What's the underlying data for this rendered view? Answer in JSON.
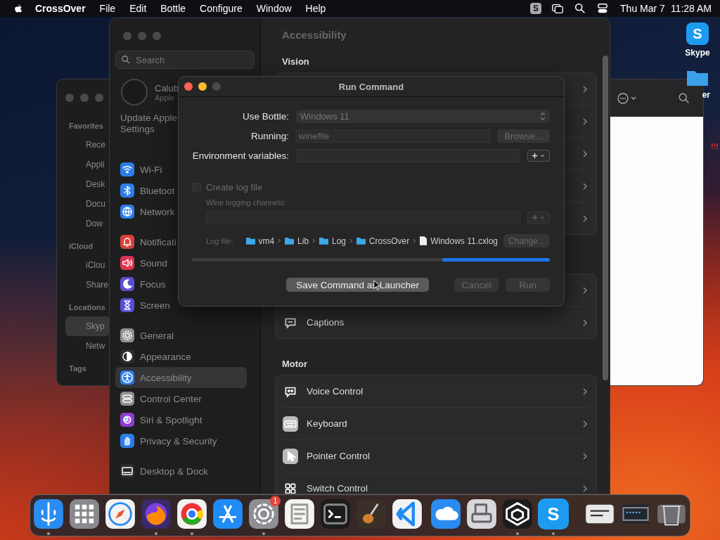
{
  "menu_bar": {
    "app": "CrossOver",
    "menus": [
      "File",
      "Edit",
      "Bottle",
      "Configure",
      "Window",
      "Help"
    ],
    "status_glyph": "S",
    "date": "Thu Mar 7",
    "time": "11:28 AM"
  },
  "desktop_icons": [
    {
      "label": "Skype",
      "glyph": "S",
      "color": "#1d9bf0"
    },
    {
      "label": "er",
      "color": "#3aa0e8"
    }
  ],
  "desktop_note": "!!!",
  "finder": {
    "sections": [
      {
        "heading": "Favorites",
        "items": [
          {
            "label": "Rece",
            "selected": false
          },
          {
            "label": "Appli",
            "selected": false
          },
          {
            "label": "Desk",
            "selected": false
          },
          {
            "label": "Docu",
            "selected": false
          },
          {
            "label": "Dow",
            "selected": false
          }
        ]
      },
      {
        "heading": "iCloud",
        "items": [
          {
            "label": "iClou",
            "selected": false
          },
          {
            "label": "Share",
            "selected": false
          }
        ]
      },
      {
        "heading": "Locations",
        "items": [
          {
            "label": "Skyp",
            "selected": true
          },
          {
            "label": "Netw",
            "selected": false
          }
        ]
      },
      {
        "heading": "Tags"
      }
    ]
  },
  "settings": {
    "search": {
      "placeholder": "Search"
    },
    "profile": {
      "name": "Calub",
      "subtitle": "Apple"
    },
    "notice": "Update Apple Settings",
    "groups": [
      {
        "items": [
          {
            "label": "Wi-Fi",
            "color": "#2b7de9",
            "selected": false
          },
          {
            "label": "Bluetoot",
            "color": "#2b7de9",
            "selected": false
          },
          {
            "label": "Network",
            "color": "#2b7de9",
            "selected": false
          }
        ]
      },
      {
        "items": [
          {
            "label": "Notificati",
            "color": "#d9413b",
            "selected": false
          },
          {
            "label": "Sound",
            "color": "#d9344f",
            "selected": false
          },
          {
            "label": "Focus",
            "color": "#5b4fd6",
            "selected": false
          },
          {
            "label": "Screen",
            "color": "#5b4fd6",
            "selected": false
          }
        ]
      },
      {
        "items": [
          {
            "label": "General",
            "color": "#8e8e93",
            "selected": false
          },
          {
            "label": "Appearance",
            "color": "#2c2c2e",
            "selected": false
          },
          {
            "label": "Accessibility",
            "color": "#2b7de9",
            "selected": true
          },
          {
            "label": "Control Center",
            "color": "#8e8e93",
            "selected": false
          },
          {
            "label": "Siri & Spotlight",
            "color": "#8a3ecf",
            "selected": false
          },
          {
            "label": "Privacy & Security",
            "color": "#2b7de9",
            "selected": false
          }
        ]
      },
      {
        "items": [
          {
            "label": "Desktop & Dock",
            "color": "#2c2c2e",
            "selected": false
          }
        ]
      }
    ],
    "title": "Accessibility",
    "vision_heading": "Vision",
    "hearing_rows": [
      {
        "label": "Captions"
      }
    ],
    "motor_heading": "Motor",
    "motor_rows": [
      {
        "label": "Voice Control"
      },
      {
        "label": "Keyboard"
      },
      {
        "label": "Pointer Control"
      },
      {
        "label": "Switch Control"
      }
    ]
  },
  "dialog": {
    "title": "Run Command",
    "bottle": {
      "label": "Use Bottle:",
      "value": "Windows 11",
      "disabled": true
    },
    "running": {
      "label": "Running:",
      "placeholder": "winefile"
    },
    "browse": {
      "label": "Browse...",
      "disabled": true
    },
    "env": {
      "label": "Environment variables:"
    },
    "log": {
      "label": "Create log file",
      "checked": false,
      "disabled": true
    },
    "channels_label": "Wine logging channels:",
    "log_file_label": "Log file:",
    "path": [
      {
        "name": "vm4",
        "kind": "folder"
      },
      {
        "name": "Lib",
        "kind": "folder"
      },
      {
        "name": "Log",
        "kind": "folder"
      },
      {
        "name": "CrossOver",
        "kind": "folder"
      },
      {
        "name": "Windows 11.cxlog",
        "kind": "file"
      }
    ],
    "change": {
      "label": "Change...",
      "disabled": true
    },
    "progress": {
      "level": 0.3
    },
    "buttons": [
      {
        "label": "Save Command as Launcher",
        "disabled": false
      },
      {
        "label": "Cancel",
        "disabled": true
      },
      {
        "label": "Run",
        "disabled": true
      }
    ]
  },
  "dock": {
    "apps": [
      {
        "color": "#2a8cf0",
        "running": true
      },
      {
        "color": "#8a8a8e",
        "running": false
      },
      {
        "color": "#f2f2f2",
        "running": false
      },
      {
        "color": "#3a2a6a",
        "running": true
      },
      {
        "color": "#f2f2f2",
        "running": true
      },
      {
        "color": "#1f8cf5",
        "running": false
      },
      {
        "color": "#8e8e93",
        "running": true,
        "badge": "1"
      },
      {
        "color": "#f5f5f0",
        "running": false
      },
      {
        "color": "#1c1c1c",
        "running": false
      },
      {
        "color": "#3a3028",
        "running": false
      },
      {
        "color": "#f2f2f2",
        "running": false
      },
      {
        "color": "#2a8cf0",
        "running": false
      },
      {
        "color": "#d8d8dc",
        "running": false
      },
      {
        "color": "#1c1c1c",
        "running": true
      },
      {
        "color": "#1d9bf0",
        "running": true,
        "glyph": "S"
      }
    ],
    "others": [
      {
        "color": "#e8e8e8"
      },
      {
        "color": "#1e2630"
      },
      {
        "color": "#6e6e73"
      }
    ]
  }
}
